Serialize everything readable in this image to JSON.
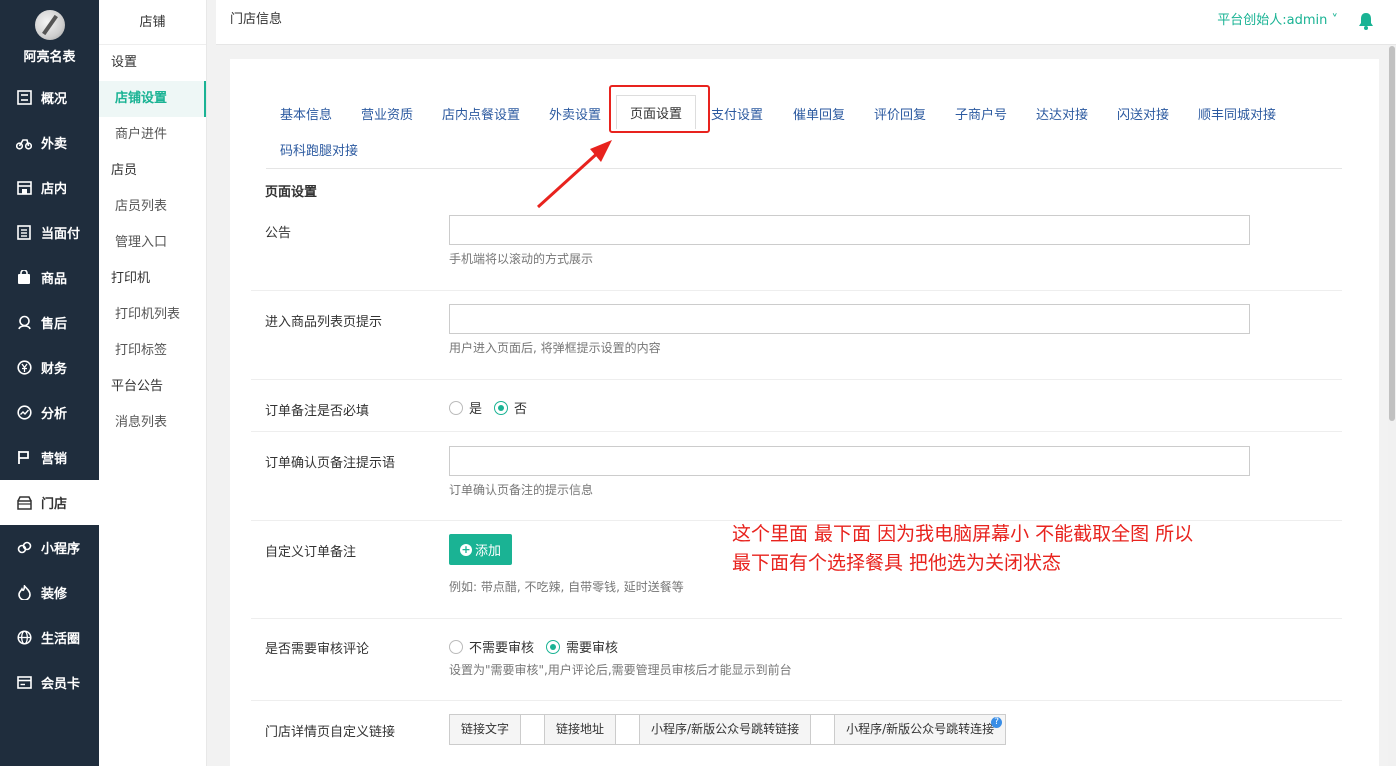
{
  "brand": {
    "name": "阿亮名表"
  },
  "sidebar": {
    "items": [
      {
        "label": "概况",
        "icon": "dashboard-icon"
      },
      {
        "label": "外卖",
        "icon": "bike-icon"
      },
      {
        "label": "店内",
        "icon": "store-icon"
      },
      {
        "label": "当面付",
        "icon": "receipt-icon"
      },
      {
        "label": "商品",
        "icon": "bag-icon"
      },
      {
        "label": "售后",
        "icon": "service-icon"
      },
      {
        "label": "财务",
        "icon": "yen-icon"
      },
      {
        "label": "分析",
        "icon": "chart-icon"
      },
      {
        "label": "营销",
        "icon": "flag-icon"
      },
      {
        "label": "门店",
        "icon": "shop-icon"
      },
      {
        "label": "小程序",
        "icon": "miniapp-icon"
      },
      {
        "label": "装修",
        "icon": "fire-icon"
      },
      {
        "label": "生活圈",
        "icon": "globe-icon"
      },
      {
        "label": "会员卡",
        "icon": "card-icon"
      }
    ]
  },
  "subnav": {
    "title": "店铺",
    "group1": "设置",
    "item_store_settings": "店铺设置",
    "item_merchant_onboarding": "商户进件",
    "group2": "店员",
    "item_staff_list": "店员列表",
    "item_admin_entry": "管理入口",
    "group3": "打印机",
    "item_printer_list": "打印机列表",
    "item_print_label": "打印标签",
    "group4": "平台公告",
    "item_message_list": "消息列表"
  },
  "header": {
    "title": "门店信息",
    "user": "平台创始人:admin ˅"
  },
  "tabs": [
    "基本信息",
    "营业资质",
    "店内点餐设置",
    "外卖设置",
    "页面设置",
    "支付设置",
    "催单回复",
    "评价回复",
    "子商户号",
    "达达对接",
    "闪送对接",
    "顺丰同城对接",
    "码科跑腿对接"
  ],
  "form": {
    "section_title": "页面设置",
    "notice": {
      "label": "公告",
      "value": "",
      "hint": "手机端将以滚动的方式展示"
    },
    "list_tip": {
      "label": "进入商品列表页提示",
      "value": "",
      "hint": "用户进入页面后, 将弹框提示设置的内容"
    },
    "remark_required": {
      "label": "订单备注是否必填",
      "option_yes": "是",
      "option_no": "否",
      "selected": "否"
    },
    "remark_placeholder": {
      "label": "订单确认页备注提示语",
      "value": "",
      "hint": "订单确认页备注的提示信息"
    },
    "custom_remark": {
      "label": "自定义订单备注",
      "button": "添加",
      "hint": "例如: 带点醋, 不吃辣, 自带零钱, 延时送餐等"
    },
    "review_audit": {
      "label": "是否需要审核评论",
      "option_no": "不需要审核",
      "option_yes": "需要审核",
      "selected": "需要审核",
      "hint": "设置为\"需要审核\",用户评论后,需要管理员审核后才能显示到前台"
    },
    "custom_link": {
      "label": "门店详情页自定义链接",
      "addon_text": "链接文字",
      "addon_url": "链接地址",
      "addon_miniapp": "小程序/新版公众号跳转链接",
      "addon_miniapp2": "小程序/新版公众号跳转连接"
    }
  },
  "annotation": {
    "line1": "这个里面 最下面 因为我电脑屏幕小 不能截取全图 所以",
    "line2": "最下面有个选择餐具  把他选为关闭状态"
  },
  "colors": {
    "accent": "#1ab394",
    "sidebar_bg": "#1f2d3d",
    "annotation": "#e8231e",
    "link": "#2c5aa0"
  }
}
